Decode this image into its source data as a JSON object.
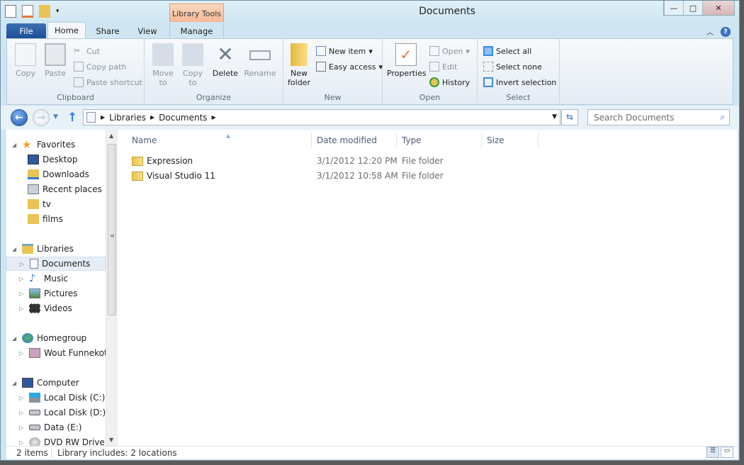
{
  "window": {
    "title": "Documents",
    "minimize": "—",
    "maximize": "□",
    "close": "✕"
  },
  "contextual_tab": "Library Tools",
  "tabs": [
    "File",
    "Home",
    "Share",
    "View",
    "Manage"
  ],
  "ribbon": {
    "clipboard": {
      "label": "Clipboard",
      "copy": "Copy",
      "paste": "Paste",
      "cut": "Cut",
      "copy_path": "Copy path",
      "paste_shortcut": "Paste shortcut"
    },
    "organize": {
      "label": "Organize",
      "move_to": "Move to",
      "copy_to": "Copy to",
      "delete": "Delete",
      "rename": "Rename"
    },
    "new": {
      "label": "New",
      "new_folder": "New folder",
      "new_item": "New item",
      "easy_access": "Easy access"
    },
    "open": {
      "label": "Open",
      "properties": "Properties",
      "open": "Open",
      "edit": "Edit",
      "history": "History"
    },
    "select": {
      "label": "Select",
      "select_all": "Select all",
      "select_none": "Select none",
      "invert": "Invert selection"
    }
  },
  "address": {
    "crumbs": [
      "Libraries",
      "Documents"
    ],
    "search_placeholder": "Search Documents"
  },
  "nav": {
    "favorites": {
      "label": "Favorites",
      "items": [
        "Desktop",
        "Downloads",
        "Recent places",
        "tv",
        "films"
      ]
    },
    "libraries": {
      "label": "Libraries",
      "items": [
        "Documents",
        "Music",
        "Pictures",
        "Videos"
      ]
    },
    "homegroup": {
      "label": "Homegroup",
      "items": [
        "Wout Funnekotter"
      ]
    },
    "computer": {
      "label": "Computer",
      "items": [
        "Local Disk (C:)",
        "Local Disk (D:)",
        "Data (E:)",
        "DVD RW Drive (K:)"
      ]
    }
  },
  "columns": [
    "Name",
    "Date modified",
    "Type",
    "Size"
  ],
  "files": [
    {
      "name": "Expression",
      "date": "3/1/2012 12:20 PM",
      "type": "File folder",
      "size": ""
    },
    {
      "name": "Visual Studio 11",
      "date": "3/1/2012 10:58 AM",
      "type": "File folder",
      "size": ""
    }
  ],
  "status": {
    "count": "2 items",
    "library": "Library includes: 2 locations"
  }
}
